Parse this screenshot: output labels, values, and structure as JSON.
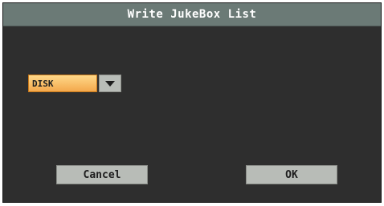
{
  "dialog": {
    "title": "Write JukeBox List",
    "destination": {
      "selected": "DISK",
      "icon": "chevron-down-icon"
    },
    "buttons": {
      "cancel_label": "Cancel",
      "ok_label": "OK"
    }
  },
  "colors": {
    "background": "#2e2e2e",
    "titlebar": "#6b7a76",
    "select_highlight": "#f3a84c",
    "button": "#b8bcb7"
  }
}
